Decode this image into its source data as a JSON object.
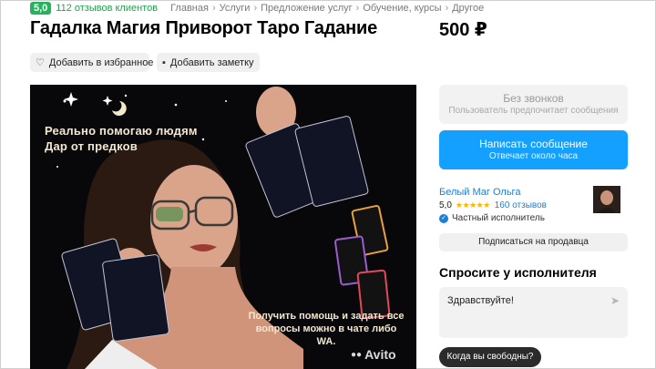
{
  "header": {
    "rating": "5,0",
    "reviews": "112 отзывов клиентов",
    "breadcrumbs": [
      "Главная",
      "Услуги",
      "Предложение услуг",
      "Обучение, курсы",
      "Другое"
    ],
    "separator": "›"
  },
  "listing": {
    "title": "Гадалка Магия Приворот Таро Гадание",
    "price": "500 ₽"
  },
  "actions": {
    "favorite_label": "Добавить в избранное",
    "note_label": "Добавить заметку"
  },
  "photo": {
    "text_line1": "Реально помогаю людям",
    "text_line2": "Дар от предков",
    "bottom_text": "Получить помощь и задать все вопросы можно в чате либо WA.",
    "watermark": "Avito"
  },
  "contact": {
    "no_calls_title": "Без звонков",
    "no_calls_sub": "Пользователь предпочитает сообщения",
    "write_title": "Написать сообщение",
    "write_sub": "Отвечает около часа"
  },
  "seller": {
    "name": "Белый Маг Ольга",
    "rating": "5,0",
    "stars": "★★★★★",
    "reviews": "160 отзывов",
    "type": "Частный исполнитель",
    "subscribe_label": "Подписаться на продавца"
  },
  "ask": {
    "heading": "Спросите у исполнителя",
    "input_value": "Здравствуйте!",
    "quick_question": "Когда вы свободны?"
  },
  "colors": {
    "accent_blue": "#14a0ff",
    "rating_green": "#24b35a",
    "link_blue": "#1d7fd6"
  }
}
